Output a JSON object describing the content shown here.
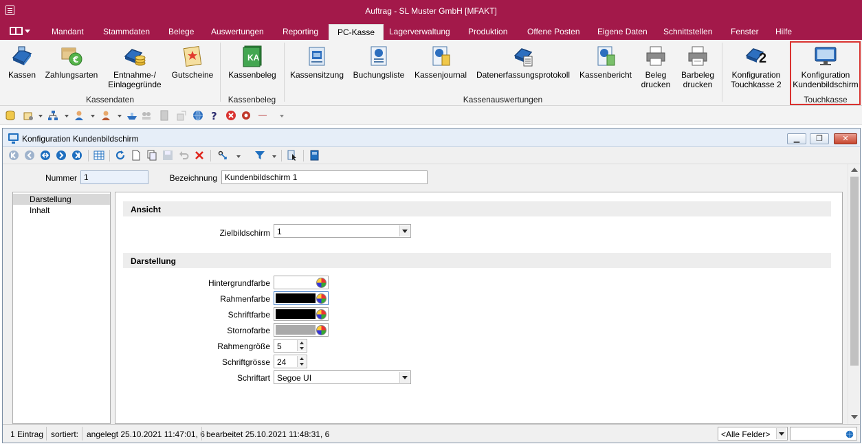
{
  "window": {
    "title": "Auftrag - SL Muster GmbH [MFAKT]"
  },
  "menu": {
    "items": [
      {
        "label": "Mandant"
      },
      {
        "label": "Stammdaten"
      },
      {
        "label": "Belege"
      },
      {
        "label": "Auswertungen"
      },
      {
        "label": "Reporting"
      },
      {
        "label": "PC-Kasse",
        "active": true
      },
      {
        "label": "Lagerverwaltung"
      },
      {
        "label": "Produktion"
      },
      {
        "label": "Offene Posten"
      },
      {
        "label": "Eigene Daten"
      },
      {
        "label": "Schnittstellen"
      },
      {
        "label": "Fenster"
      },
      {
        "label": "Hilfe"
      }
    ]
  },
  "ribbon": {
    "groups": {
      "kassendaten": "Kassendaten",
      "kassenbeleg": "Kassenbeleg",
      "kassenauswertungen": "Kassenauswertungen",
      "touchkasse": "Touchkasse"
    },
    "buttons": {
      "kassen": {
        "l1": "Kassen"
      },
      "zahlungsarten": {
        "l1": "Zahlungsarten"
      },
      "entnahme": {
        "l1": "Entnahme-/",
        "l2": "Einlagegründe"
      },
      "gutscheine": {
        "l1": "Gutscheine"
      },
      "kassenbeleg": {
        "l1": "Kassenbeleg",
        "icon_text": "KA"
      },
      "kassensitzung": {
        "l1": "Kassensitzung"
      },
      "buchungsliste": {
        "l1": "Buchungsliste"
      },
      "kassenjournal": {
        "l1": "Kassenjournal"
      },
      "datenerfassung": {
        "l1": "Datenerfassungsprotokoll"
      },
      "kassenbericht": {
        "l1": "Kassenbericht"
      },
      "beleg_drucken": {
        "l1": "Beleg",
        "l2": "drucken"
      },
      "barbeleg_drucken": {
        "l1": "Barbeleg",
        "l2": "drucken"
      },
      "konfig_touch": {
        "l1": "Konfiguration",
        "l2": "Touchkasse 2",
        "icon_text": "2"
      },
      "konfig_kunden": {
        "l1": "Konfiguration",
        "l2": "Kundenbildschirm"
      }
    }
  },
  "child_window": {
    "title": "Konfiguration Kundenbildschirm"
  },
  "form": {
    "nummer_label": "Nummer",
    "nummer_value": "1",
    "bezeichnung_label": "Bezeichnung",
    "bezeichnung_value": "Kundenbildschirm 1"
  },
  "tree": {
    "items": [
      {
        "label": "Darstellung",
        "selected": true
      },
      {
        "label": "Inhalt"
      }
    ]
  },
  "panel": {
    "section_ansicht": "Ansicht",
    "zielbildschirm_label": "Zielbildschirm",
    "zielbildschirm_value": "1",
    "section_darstellung": "Darstellung",
    "hintergrundfarbe_label": "Hintergrundfarbe",
    "rahmenfarbe_label": "Rahmenfarbe",
    "schriftfarbe_label": "Schriftfarbe",
    "stornofarbe_label": "Stornofarbe",
    "rahmengroesse_label": "Rahmengröße",
    "rahmengroesse_value": "5",
    "schriftgroesse_label": "Schriftgrösse",
    "schriftgroesse_value": "24",
    "schriftart_label": "Schriftart",
    "schriftart_value": "Segoe UI"
  },
  "colors": {
    "hintergrundfarbe": "#ffffff",
    "rahmenfarbe": "#000000",
    "schriftfarbe": "#000000",
    "stornofarbe": "#a9a9a9",
    "accent": "#a3194a",
    "highlight": "#d9322f"
  },
  "status": {
    "count": "1 Eintrag",
    "sort": "sortiert:",
    "created": "angelegt 25.10.2021 11:47:01,  6",
    "edited": "bearbeitet 25.10.2021 11:48:31,  6",
    "fields": "<Alle Felder>"
  }
}
